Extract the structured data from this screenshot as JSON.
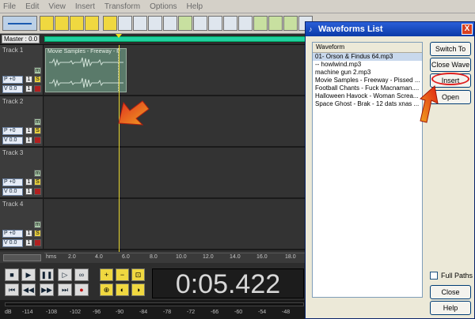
{
  "menu": [
    "File",
    "Edit",
    "View",
    "Insert",
    "Transform",
    "Options",
    "Help"
  ],
  "master_label": "Master : 0.0",
  "tracks": [
    {
      "name": "Track 1",
      "pan": "P +0",
      "vol": "V 0.0"
    },
    {
      "name": "Track 2",
      "pan": "P +0",
      "vol": "V 0.0"
    },
    {
      "name": "Track 3",
      "pan": "P +0",
      "vol": "V 0.0"
    },
    {
      "name": "Track 4",
      "pan": "P +0",
      "vol": "V 0.0"
    }
  ],
  "track_buttons": {
    "mute": "m",
    "one": "1",
    "solo": "S"
  },
  "clip": {
    "title": "Movie Samples - Freeway - P"
  },
  "ruler": {
    "unit": "hms",
    "ticks": [
      "2.0",
      "4.0",
      "6.0",
      "8.0",
      "10.0",
      "12.0",
      "14.0",
      "16.0",
      "18.0"
    ]
  },
  "time_display": "0:05.422",
  "meter_ticks": [
    "dB",
    "-114",
    "-108",
    "-102",
    "-96",
    "-90",
    "-84",
    "-78",
    "-72",
    "-66",
    "-60",
    "-54",
    "-48"
  ],
  "dialog": {
    "title": "Waveforms List",
    "close": "X",
    "list_header": "Waveform",
    "items": [
      "01- Orson & Findus 64.mp3",
      "-- howlwind.mp3",
      "machine gun 2.mp3",
      "Movie Samples - Freeway - Pissed ...",
      "Football Chants - Fuck Macnaman....",
      "Halloween Havock - Woman Screa...",
      "Space Ghost - Brak - 12 dats xnas ..."
    ],
    "buttons": {
      "switch_to": "Switch To",
      "close_wave": "Close Wave",
      "insert": "Insert",
      "open": "Open",
      "close": "Close",
      "help": "Help"
    },
    "full_paths": "Full Paths"
  },
  "colors": {
    "accent": "#20d0a0",
    "cursor": "#e8d830",
    "titlebar": "#0a3aa8",
    "annotation": "#e02020"
  }
}
